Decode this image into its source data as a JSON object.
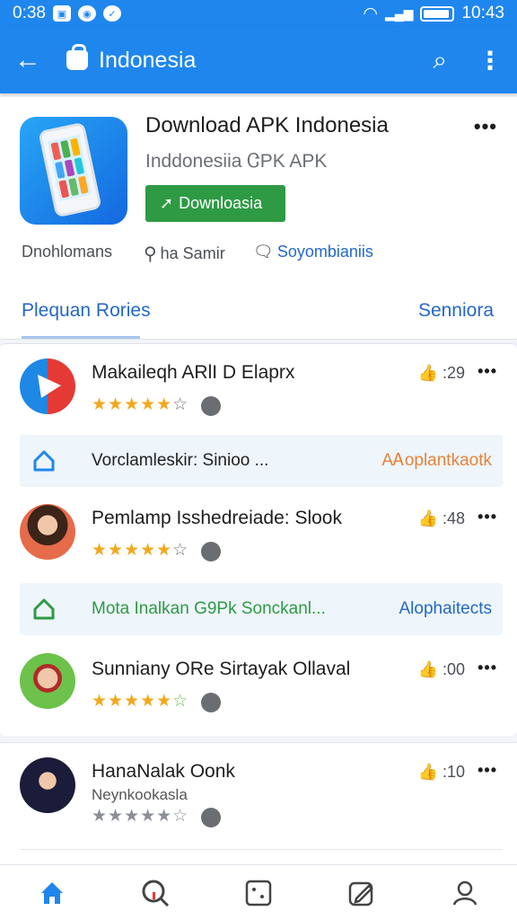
{
  "status_bar": {
    "time_left": "0:38",
    "time_right": "10:43"
  },
  "app_bar": {
    "title": "Indonesia"
  },
  "app": {
    "title": "Download APK Indonesia",
    "developer": "Inddonesiia ᏣPK APK",
    "download_label": "Downloasia",
    "meta": [
      "Dnohlomans",
      "ha Samir",
      "Soyombianiis"
    ]
  },
  "tabs": {
    "left": "Plequan Rories",
    "right": "Senniora"
  },
  "items": [
    {
      "name": "Makaileqh ARlI D Elaprx",
      "likes": ":29"
    },
    {
      "name": "Pemlamp Isshedreiade: Slook",
      "likes": ":48"
    },
    {
      "name": "Sunniany ORe Sirtayak Ollaval",
      "likes": ":00"
    },
    {
      "name": "HanaNalak Oonk",
      "likes": ":10",
      "subtitle": "Neynkookasla"
    }
  ],
  "promos": [
    {
      "text": "Vorclamleskir: Sinioo ...",
      "action": "AᎪoplantkaotk",
      "color": "#222222",
      "action_color": "#e6843a"
    },
    {
      "text": "Mota Inalkan G9Pk Sonckanl...",
      "action": "Alophaitects",
      "color": "#2e9a44",
      "action_color": "#2468c7"
    }
  ],
  "colors": {
    "primary": "#1f86ee",
    "download": "#2e9a44",
    "link": "#2468c7",
    "star": "#f2a81d"
  },
  "icons": [
    "back-arrow-icon",
    "shopping-bag-icon",
    "search-icon",
    "more-vert-icon",
    "home-icon",
    "search-question-icon",
    "dice-icon",
    "edit-icon",
    "profile-icon"
  ]
}
